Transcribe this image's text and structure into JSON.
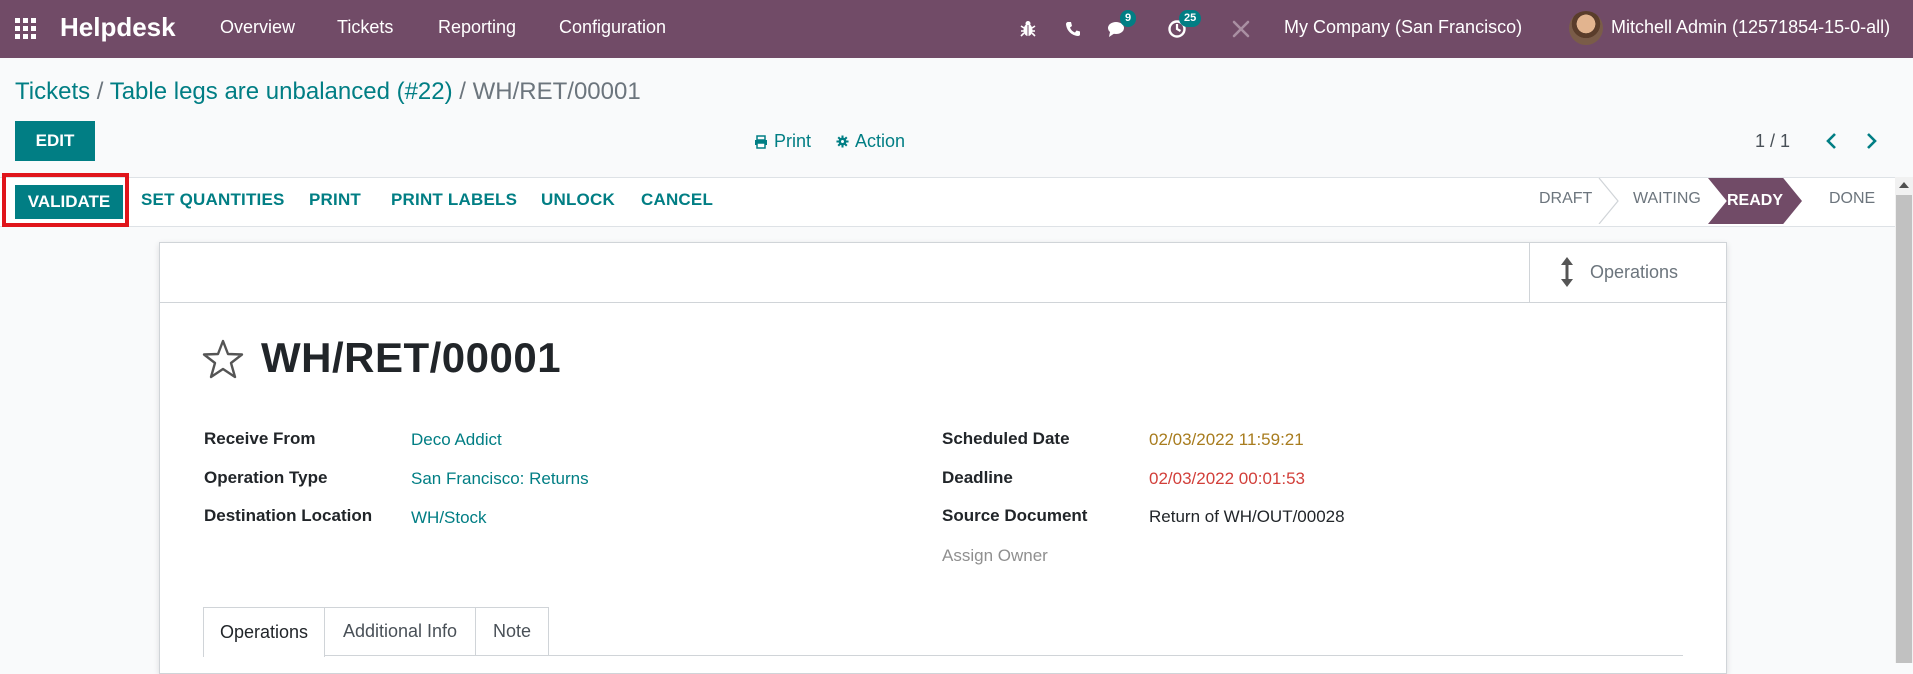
{
  "navbar": {
    "brand": "Helpdesk",
    "menu": [
      "Overview",
      "Tickets",
      "Reporting",
      "Configuration"
    ],
    "messages_count": "9",
    "activities_count": "25",
    "company": "My Company (San Francisco)",
    "user": "Mitchell Admin (12571854-15-0-all)",
    "bg_color": "#714b67"
  },
  "breadcrumb": {
    "root": "Tickets",
    "parent": "Table legs are unbalanced (#22)",
    "current": "WH/RET/00001",
    "separator": "/"
  },
  "controls": {
    "edit_label": "EDIT",
    "print_label": "Print",
    "action_label": "Action",
    "pager": "1 / 1"
  },
  "statusbar": {
    "buttons": [
      "VALIDATE",
      "SET QUANTITIES",
      "PRINT",
      "PRINT LABELS",
      "UNLOCK",
      "CANCEL"
    ],
    "stages": [
      "DRAFT",
      "WAITING",
      "READY",
      "DONE"
    ],
    "active_stage": "READY"
  },
  "sheet": {
    "smart_button": "Operations",
    "title": "WH/RET/00001",
    "left_fields": [
      {
        "label": "Receive From",
        "value": "Deco Addict"
      },
      {
        "label": "Operation Type",
        "value": "San Francisco: Returns"
      },
      {
        "label": "Destination Location",
        "value": "WH/Stock"
      }
    ],
    "right_fields": [
      {
        "label": "Scheduled Date",
        "value": "02/03/2022 11:59:21"
      },
      {
        "label": "Deadline",
        "value": "02/03/2022 00:01:53"
      },
      {
        "label": "Source Document",
        "value": "Return of WH/OUT/00028"
      }
    ],
    "assign_owner": "Assign Owner",
    "tabs": [
      "Operations",
      "Additional Info",
      "Note"
    ],
    "active_tab": "Operations"
  },
  "colors": {
    "primary": "#714b67",
    "accent": "#017e84",
    "highlight": "#e0151b",
    "date_warning": "#a87c1e",
    "date_danger": "#d23f3a"
  }
}
